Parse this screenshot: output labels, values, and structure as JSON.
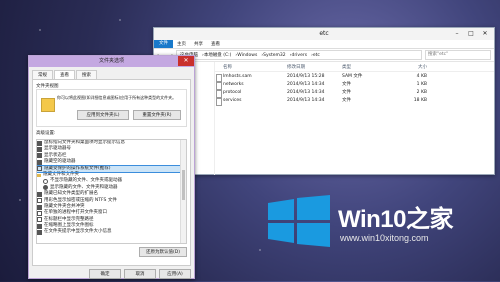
{
  "explorer": {
    "title": "etc",
    "ribbon": {
      "file_tab": "文件",
      "tabs": [
        "主页",
        "共享",
        "查看"
      ]
    },
    "path": [
      "这台电脑",
      "本地磁盘 (C:)",
      "Windows",
      "System32",
      "drivers",
      "etc"
    ],
    "search_placeholder": "搜索\"etc\"",
    "columns": [
      "名称",
      "修改日期",
      "类型",
      "大小"
    ],
    "files": [
      {
        "name": "lmhosts.sam",
        "date": "2014/9/13 15:28",
        "type": "SAM 文件",
        "size": "4 KB"
      },
      {
        "name": "networks",
        "date": "2014/9/13 14:34",
        "type": "文件",
        "size": "1 KB"
      },
      {
        "name": "protocol",
        "date": "2014/9/13 14:34",
        "type": "文件",
        "size": "2 KB"
      },
      {
        "name": "services",
        "date": "2014/9/13 14:34",
        "type": "文件",
        "size": "18 KB"
      }
    ]
  },
  "dialog": {
    "title": "文件夹选项",
    "tabs": [
      "常规",
      "查看",
      "搜索"
    ],
    "view_group_label": "文件夹视图",
    "view_desc": "你可以将此视图(如详细信息或图标)应用于所有这种类型的文件夹。",
    "apply_button": "应用到文件夹(L)",
    "reset_button": "重置文件夹(R)",
    "advanced_label": "高级设置:",
    "advanced_items": [
      {
        "label": "鼠标指向文件夹和桌面项时显示提示信息",
        "kind": "check",
        "checked": true
      },
      {
        "label": "显示驱动器号",
        "kind": "check",
        "checked": true
      },
      {
        "label": "显示状态栏",
        "kind": "check",
        "checked": true
      },
      {
        "label": "隐藏空的驱动器",
        "kind": "check",
        "checked": true
      },
      {
        "label": "隐藏受保护的操作系统文件(推荐)",
        "kind": "check",
        "checked": false,
        "highlight": true
      },
      {
        "label": "隐藏文件和文件夹",
        "kind": "folder"
      },
      {
        "label": "不显示隐藏的文件、文件夹或驱动器",
        "kind": "radio",
        "selected": false
      },
      {
        "label": "显示隐藏的文件、文件夹和驱动器",
        "kind": "radio",
        "selected": true
      },
      {
        "label": "隐藏已知文件类型的扩展名",
        "kind": "check",
        "checked": true
      },
      {
        "label": "用彩色显示加密或压缩的 NTFS 文件",
        "kind": "check",
        "checked": false
      },
      {
        "label": "隐藏文件夹合并冲突",
        "kind": "check",
        "checked": true
      },
      {
        "label": "在单独的进程中打开文件夹窗口",
        "kind": "check",
        "checked": false
      },
      {
        "label": "在标题栏中显示完整路径",
        "kind": "check",
        "checked": false
      },
      {
        "label": "在缩略图上显示文件图标",
        "kind": "check",
        "checked": true
      },
      {
        "label": "在文件夹提示中显示文件大小信息",
        "kind": "check",
        "checked": true
      }
    ],
    "restore_button": "还原为默认值(D)",
    "ok_button": "确定",
    "cancel_button": "取消",
    "apply_footer": "应用(A)"
  },
  "brand": {
    "name": "Win10",
    "name_zh": "之家",
    "url": "www.win10xitong.com"
  },
  "colors": {
    "accent": "#1979ca",
    "dialog_title": "#c4a8e1",
    "logo_blue": "#1a9ae0"
  }
}
